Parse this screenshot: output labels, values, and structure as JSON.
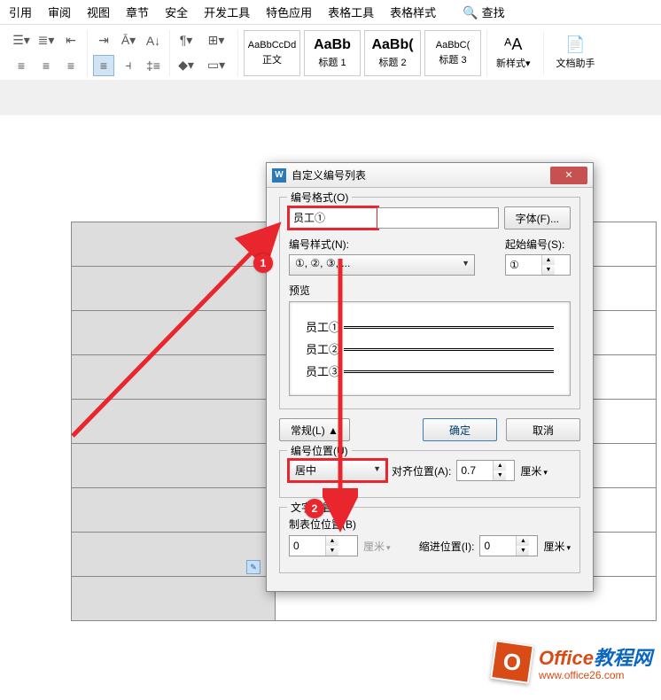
{
  "ribbon": {
    "tabs": [
      "引用",
      "审阅",
      "视图",
      "章节",
      "安全",
      "开发工具",
      "特色应用",
      "表格工具",
      "表格样式"
    ],
    "search": "查找",
    "styles": [
      {
        "preview": "AaBbCcDd",
        "label": "正文",
        "big": false
      },
      {
        "preview": "AaBb",
        "label": "标题 1",
        "big": true
      },
      {
        "preview": "AaBb(",
        "label": "标题 2",
        "big": true
      },
      {
        "preview": "AaBbC(",
        "label": "标题 3",
        "big": false
      }
    ],
    "new_style": "新样式▾",
    "doc_helper": "文档助手"
  },
  "dialog": {
    "title": "自定义编号列表",
    "format_group": "编号格式(O)",
    "format_value": "员工①",
    "font_btn": "字体(F)...",
    "style_label": "编号样式(N):",
    "style_value": "①, ②, ③, ...",
    "start_label": "起始编号(S):",
    "start_value": "①",
    "preview_label": "预览",
    "preview_lines": [
      "员工①",
      "员工②",
      "员工③"
    ],
    "normal_btn": "常规(L) ▲",
    "ok_btn": "确定",
    "cancel_btn": "取消",
    "pos_group": "编号位置(U)",
    "pos_value": "居中",
    "align_label": "对齐位置(A):",
    "align_value": "0.7",
    "unit": "厘米",
    "text_group": "文字位置",
    "tab_label": "制表位位置(B)",
    "tab_value": "0",
    "indent_label": "缩进位置(I):",
    "indent_value": "0"
  },
  "annotations": {
    "marker1": "1",
    "marker2": "2"
  },
  "watermark": {
    "brand_part1": "Office",
    "brand_part2": "教程网",
    "url": "www.office26.com"
  }
}
